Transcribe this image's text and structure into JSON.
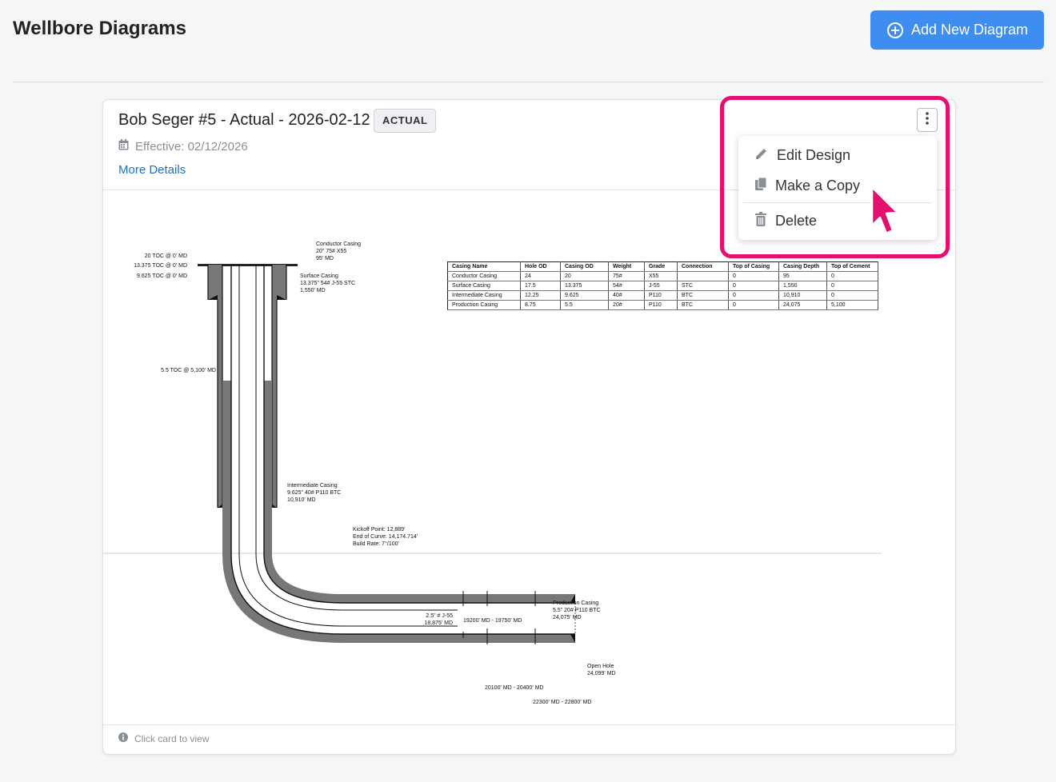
{
  "page": {
    "title": "Wellbore Diagrams",
    "add_button_label": "Add New Diagram"
  },
  "card": {
    "title": "Bob Seger #5 - Actual - 2026-02-12",
    "badge": "ACTUAL",
    "effective": "Effective: 02/12/2026",
    "more_details": "More Details",
    "footer_hint": "Click card to view"
  },
  "menu": {
    "edit": "Edit Design",
    "copy": "Make a Copy",
    "delete": "Delete"
  },
  "highlight_color": "#e5106d",
  "diagram": {
    "labels": {
      "toc20": "20 TOC @ 0' MD",
      "toc13": "13.375 TOC @ 0' MD",
      "toc9": "9.625 TOC @ 0' MD",
      "toc55": "5.5 TOC @ 5,100' MD",
      "conductor1": "Conductor Casing",
      "conductor2": "20\" 75# X55",
      "conductor3": "95' MD",
      "surface1": "Surface Casing",
      "surface2": "13.375\" 54# J-55 STC",
      "surface3": "1,550' MD",
      "inter1": "Intermediate Casing",
      "inter2": "9.625\" 40# P110 BTC",
      "inter3": "10,910' MD",
      "kick1": "Kickoff Point: 12,889'",
      "kick2": "End of Curve: 14,174.714'",
      "kick3": "Build Rate: 7°/100'",
      "tubing1": "2.5\" # J-55",
      "tubing2": "18,875' MD",
      "range1": "19200' MD - 19750' MD",
      "prod1": "Production Casing",
      "prod2": "5.5\" 20# P110 BTC",
      "prod3": "24,075' MD",
      "open1": "Open Hole",
      "open2": "24,099' MD",
      "range2": "20100' MD - 20400' MD",
      "range3": "22300' MD - 22800' MD"
    },
    "table": {
      "headers": [
        "Casing Name",
        "Hole OD",
        "Casing OD",
        "Weight",
        "Grade",
        "Connection",
        "Top of Casing",
        "Casing Depth",
        "Top of Cement"
      ],
      "rows": [
        [
          "Conductor Casing",
          "24",
          "20",
          "75#",
          "X55",
          "",
          "0",
          "95",
          "0"
        ],
        [
          "Surface Casing",
          "17.5",
          "13.375",
          "54#",
          "J-55",
          "STC",
          "0",
          "1,550",
          "0"
        ],
        [
          "Intermediate Casing",
          "12.25",
          "9.625",
          "40#",
          "P110",
          "BTC",
          "0",
          "10,910",
          "0"
        ],
        [
          "Production Casing",
          "8.75",
          "5.5",
          "20#",
          "P110",
          "BTC",
          "0",
          "24,075",
          "5,100"
        ]
      ]
    }
  }
}
